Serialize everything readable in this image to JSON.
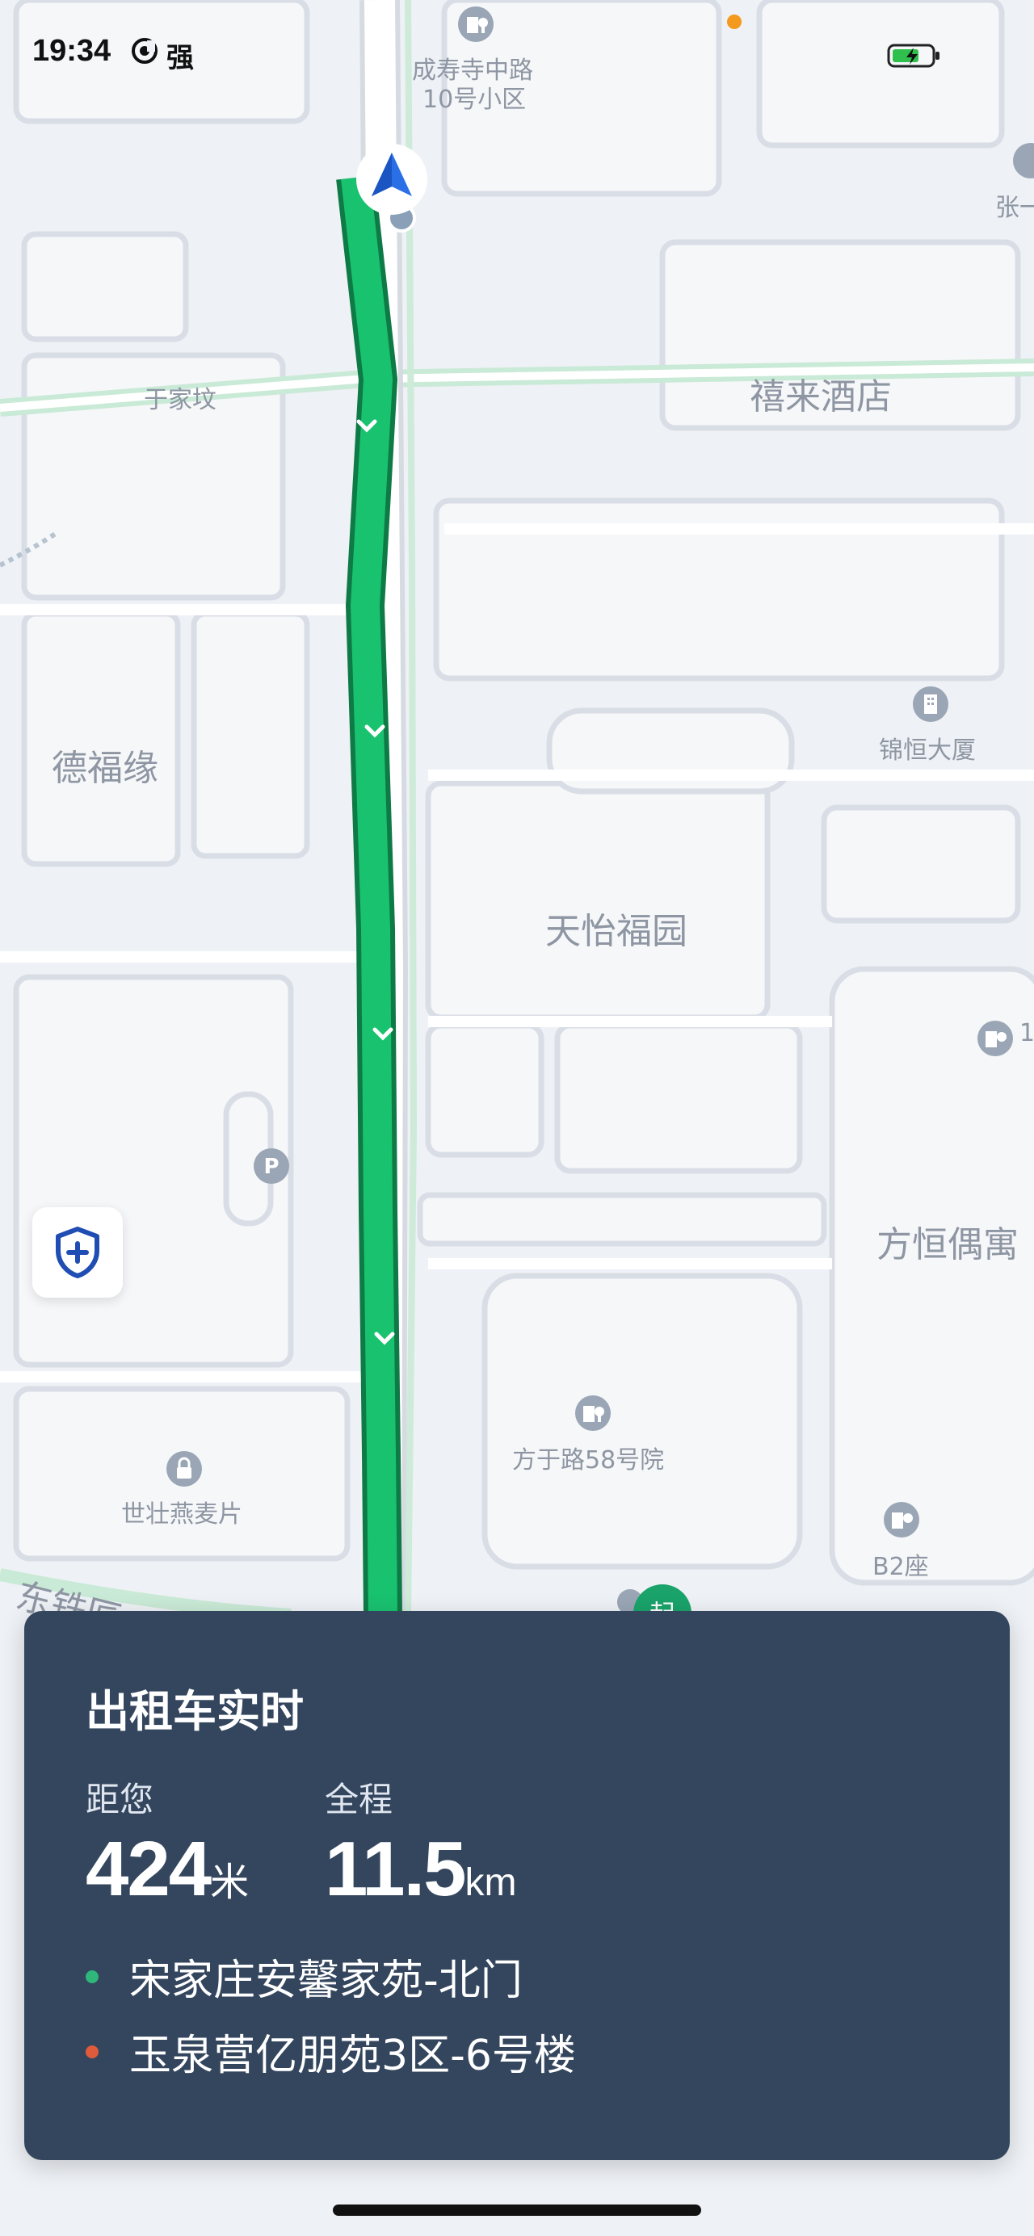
{
  "status_bar": {
    "time": "19:34",
    "carrier": "强"
  },
  "map": {
    "labels": [
      {
        "id": "chengshousi",
        "text": "成寿寺中路"
      },
      {
        "id": "chengshousi2",
        "text": "10号小区"
      },
      {
        "id": "zhang",
        "text": "张一"
      },
      {
        "id": "xilai",
        "text": "禧来酒店"
      },
      {
        "id": "yujiafen",
        "text": "于家坟"
      },
      {
        "id": "defuyuan",
        "text": "德福缘"
      },
      {
        "id": "jinheng",
        "text": "锦恒大厦"
      },
      {
        "id": "tianyi",
        "text": "天怡福园"
      },
      {
        "id": "fangheng",
        "text": "方恒偶寓"
      },
      {
        "id": "fangyu58",
        "text": "方于路58号院"
      },
      {
        "id": "shizhuang",
        "text": "世壮燕麦片"
      },
      {
        "id": "b2",
        "text": "B2座"
      },
      {
        "id": "dongtie",
        "text": "东铁匠"
      },
      {
        "id": "start_marker",
        "text": "起"
      },
      {
        "id": "edge_num",
        "text": "1"
      }
    ],
    "parking_label": "P",
    "route_color": "#19c26f",
    "origin_dot_color": "#2fb67a",
    "dest_dot_color": "#e05a3c"
  },
  "card": {
    "title": "出租车实时",
    "distance_label": "距您",
    "distance_value": "424",
    "distance_unit": "米",
    "total_label": "全程",
    "total_value": "11.5",
    "total_unit": "km",
    "origin": "宋家庄安馨家苑-北门",
    "destination": "玉泉营亿朋苑3区-6号楼"
  }
}
